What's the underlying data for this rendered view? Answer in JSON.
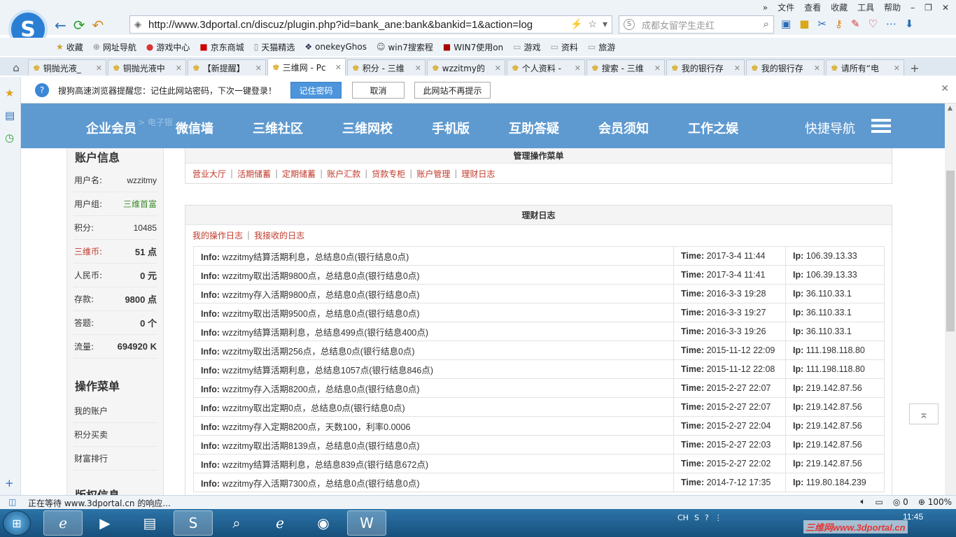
{
  "browser": {
    "menu": [
      "文件",
      "查看",
      "收藏",
      "工具",
      "帮助"
    ],
    "url": "http://www.3dportal.cn/discuz/plugin.php?id=bank_ane:bank&bankid=1&action=log",
    "search_placeholder": "成都女留学生走红",
    "bookmarks": [
      "收藏",
      "网址导航",
      "游戏中心",
      "京东商城",
      "天猫精选",
      "onekeyGhos",
      "win7搜索程",
      "WIN7使用on",
      "游戏",
      "资料",
      "旅游"
    ],
    "tabs": [
      {
        "label": "铜抛光液_",
        "active": false
      },
      {
        "label": "铜抛光液中",
        "active": false
      },
      {
        "label": "【新提醒】",
        "active": false
      },
      {
        "label": "三维网 - Pc",
        "active": true
      },
      {
        "label": "积分 - 三维",
        "active": false
      },
      {
        "label": "wzzitmy的",
        "active": false
      },
      {
        "label": "个人资料 -",
        "active": false
      },
      {
        "label": "搜索 - 三维",
        "active": false
      },
      {
        "label": "我的银行存",
        "active": false
      },
      {
        "label": "我的银行存",
        "active": false
      },
      {
        "label": "请所有“电",
        "active": false
      }
    ],
    "notice": {
      "text": "搜狗高速浏览器提醒您：记住此网站密码，下次一键登录！",
      "save": "记住密码",
      "cancel": "取消",
      "never": "此网站不再提示"
    },
    "status_text": "正在等待 www.3dportal.cn 的响应...",
    "status_zoom": "100%",
    "status_count": "0"
  },
  "site_nav": {
    "crumb": "> 电子银",
    "items": [
      "企业会员",
      "微信墙",
      "三维社区",
      "三维网校",
      "手机版",
      "互助答疑",
      "会员须知",
      "工作之娱"
    ],
    "quick": "快捷导航"
  },
  "sidebar": {
    "account_title": "账户信息",
    "rows": [
      {
        "k": "用户名:",
        "v": "wzzitmy"
      },
      {
        "k": "用户组:",
        "v": "三维首富"
      },
      {
        "k": "积分:",
        "v": "10485"
      },
      {
        "k": "三维币:",
        "v": "51 点"
      },
      {
        "k": "人民币:",
        "v": "0 元"
      },
      {
        "k": "存款:",
        "v": "9800 点"
      },
      {
        "k": "答题:",
        "v": "0 个"
      },
      {
        "k": "流量:",
        "v": "694920 K"
      }
    ],
    "menu_title": "操作菜单",
    "menu": [
      "我的账户",
      "积分买卖",
      "财富排行"
    ],
    "copyright_title": "版权信息"
  },
  "content": {
    "manage_title": "管理操作菜单",
    "manage_links": [
      "营业大厅",
      "活期储蓄",
      "定期储蓄",
      "账户汇款",
      "贷款专柜",
      "账户管理",
      "理财日志"
    ],
    "log_title": "理财日志",
    "log_links": [
      "我的操作日志",
      "我接收的日志"
    ],
    "labels": {
      "info": "Info:",
      "time": "Time:",
      "ip": "Ip:"
    },
    "logs": [
      {
        "info": "wzzitmy结算活期利息，总结息0点(银行结息0点)",
        "time": "2017-3-4 11:44",
        "ip": "106.39.13.33"
      },
      {
        "info": "wzzitmy取出活期9800点，总结息0点(银行结息0点)",
        "time": "2017-3-4 11:41",
        "ip": "106.39.13.33"
      },
      {
        "info": "wzzitmy存入活期9800点，总结息0点(银行结息0点)",
        "time": "2016-3-3 19:28",
        "ip": "36.110.33.1"
      },
      {
        "info": "wzzitmy取出活期9500点，总结息0点(银行结息0点)",
        "time": "2016-3-3 19:27",
        "ip": "36.110.33.1"
      },
      {
        "info": "wzzitmy结算活期利息，总结息499点(银行结息400点)",
        "time": "2016-3-3 19:26",
        "ip": "36.110.33.1"
      },
      {
        "info": "wzzitmy取出活期256点，总结息0点(银行结息0点)",
        "time": "2015-11-12 22:09",
        "ip": "111.198.118.80"
      },
      {
        "info": "wzzitmy结算活期利息，总结息1057点(银行结息846点)",
        "time": "2015-11-12 22:08",
        "ip": "111.198.118.80"
      },
      {
        "info": "wzzitmy存入活期8200点，总结息0点(银行结息0点)",
        "time": "2015-2-27 22:07",
        "ip": "219.142.87.56"
      },
      {
        "info": "wzzitmy取出定期0点，总结息0点(银行结息0点)",
        "time": "2015-2-27 22:07",
        "ip": "219.142.87.56"
      },
      {
        "info": "wzzitmy存入定期8200点，天数100，利率0.0006",
        "time": "2015-2-27 22:04",
        "ip": "219.142.87.56"
      },
      {
        "info": "wzzitmy取出活期8139点，总结息0点(银行结息0点)",
        "time": "2015-2-27 22:03",
        "ip": "219.142.87.56"
      },
      {
        "info": "wzzitmy结算活期利息，总结息839点(银行结息672点)",
        "time": "2015-2-27 22:02",
        "ip": "219.142.87.56"
      },
      {
        "info": "wzzitmy存入活期7300点，总结息0点(银行结息0点)",
        "time": "2014-7-12 17:35",
        "ip": "119.80.184.239"
      }
    ]
  },
  "taskbar": {
    "tray_lang": "CH",
    "clock_time": "11:45",
    "watermark": "三维网www.3dportal.cn"
  }
}
